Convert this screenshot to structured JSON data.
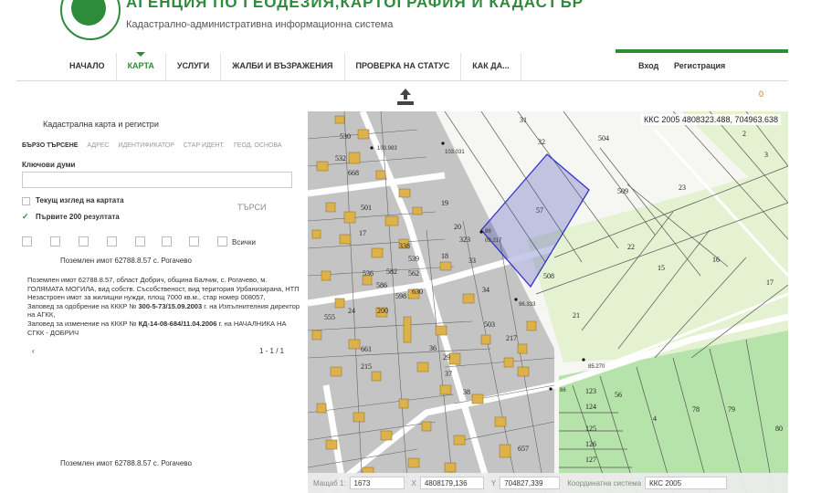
{
  "header": {
    "agency_name": "АГЕНЦИЯ ПО ГЕОДЕЗИЯ,КАРТОГРАФИЯ И КАДАСТЪР",
    "subtitle": "Кадастрално-административна информационна система"
  },
  "nav": {
    "items": [
      "НАЧАЛО",
      "КАРТА",
      "УСЛУГИ",
      "ЖАЛБИ И ВЪЗРАЖЕНИЯ",
      "ПРОВЕРКА НА СТАТУС",
      "КАК ДА..."
    ],
    "active": "КАРТА",
    "login": "Вход",
    "register": "Регистрация"
  },
  "toolbar": {
    "notification_count": "0"
  },
  "left_panel": {
    "title": "Кадастрална карта и регистри",
    "tabs": [
      "БЪРЗО ТЪРСЕНЕ",
      "АДРЕС",
      "ИДЕНТИФИКАТОР",
      "СТАР ИДЕНТ.",
      "ГЕОД. ОСНОВА"
    ],
    "keywords_label": "Ключови думи",
    "keywords_value": "",
    "opt_current_view": "Текущ изглед на картата",
    "opt_first_200": "Първите 200 резултата",
    "search_button": "ТЪРСИ",
    "all_label": "Всички",
    "result_title": "Поземлен имот 62788.8.57 с. Рогачево",
    "result_text_1": "Поземлен имот 62788.8.57, област Добрич, община Балчик, с. Рогачево, м. ГОЛЯМАТА МОГИЛА, вид собств. Съсобственост, вид територия Урбанизирана, НТП Незастроен имот за жилищни нужди, площ 7000 кв.м., стар номер 008057,",
    "result_text_2a": "Заповед за одобрение на КККР № ",
    "result_text_2b": "300-5-73/15.09.2003",
    "result_text_2c": " г. на Изпълнителния директор на АГКК,",
    "result_text_3a": "Заповед за изменение на КККР № ",
    "result_text_3b": "КД-14-08-684/11.04.2006",
    "result_text_3c": " г. на НАЧАЛНИКА НА СГКК - ДОБРИЧ",
    "pager_left": "‹",
    "pager_right": "1 - 1 / 1",
    "result_footer": "Поземлен имот 62788.8.57 с. Рогачево"
  },
  "map": {
    "coord_system_header": "ККС 2005 4808323.488, 704963.638",
    "scale_label": "Мащаб",
    "scale_prefix": "1:",
    "scale_value": "1673",
    "x_label": "X",
    "x_value": "4808179,136",
    "y_label": "Y",
    "y_value": "704827,339",
    "cs_label": "Координатна система",
    "cs_value": "ККС 2005",
    "parcel_labels": [
      "31",
      "32",
      "504",
      "2",
      "3",
      "509",
      "23",
      "57",
      "20",
      "323",
      "33",
      "508",
      "22",
      "15",
      "16",
      "17",
      "34",
      "21",
      "19",
      "501",
      "17",
      "18",
      "24",
      "200",
      "503",
      "217",
      "4",
      "78",
      "79",
      "80",
      "123",
      "124",
      "125",
      "126",
      "127",
      "56",
      "29",
      "36",
      "37",
      "38",
      "215",
      "661",
      "657",
      "536",
      "539",
      "668",
      "532",
      "530",
      "555",
      "586",
      "598",
      "630",
      "582",
      "562",
      "338"
    ],
    "point_labels": [
      "103.031",
      "89",
      "09.217",
      "96.333",
      "85.270",
      "86",
      "103.983"
    ],
    "colors": {
      "built": "#c8c8c8",
      "agri": "#dfefc9",
      "building": "#e0b450",
      "selected": "#3333cc",
      "forest": "#a5dc9a"
    }
  }
}
